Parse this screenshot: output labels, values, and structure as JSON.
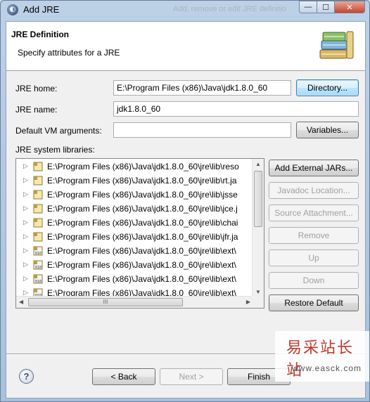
{
  "window": {
    "title": "Add JRE",
    "background_title": "Add, remove or edit JRE definitio",
    "controls": {
      "minimize": "—",
      "maximize": "☐",
      "close": "✕"
    }
  },
  "banner": {
    "title": "JRE Definition",
    "subtitle": "Specify attributes for a JRE"
  },
  "form": {
    "jre_home_label": "JRE home:",
    "jre_home_value": "E:\\Program Files (x86)\\Java\\jdk1.8.0_60",
    "directory_button": "Directory...",
    "jre_name_label": "JRE name:",
    "jre_name_value": "jdk1.8.0_60",
    "vm_args_label": "Default VM arguments:",
    "vm_args_value": "",
    "variables_button": "Variables...",
    "libraries_label": "JRE system libraries:"
  },
  "libraries": [
    "E:\\Program Files (x86)\\Java\\jdk1.8.0_60\\jre\\lib\\reso",
    "E:\\Program Files (x86)\\Java\\jdk1.8.0_60\\jre\\lib\\rt.ja",
    "E:\\Program Files (x86)\\Java\\jdk1.8.0_60\\jre\\lib\\jsse",
    "E:\\Program Files (x86)\\Java\\jdk1.8.0_60\\jre\\lib\\jce.j",
    "E:\\Program Files (x86)\\Java\\jdk1.8.0_60\\jre\\lib\\chai",
    "E:\\Program Files (x86)\\Java\\jdk1.8.0_60\\jre\\lib\\jfr.ja",
    "E:\\Program Files (x86)\\Java\\jdk1.8.0_60\\jre\\lib\\ext\\",
    "E:\\Program Files (x86)\\Java\\jdk1.8.0_60\\jre\\lib\\ext\\",
    "E:\\Program Files (x86)\\Java\\jdk1.8.0_60\\jre\\lib\\ext\\",
    "E:\\Program Files (x86)\\Java\\jdk1.8.0_60\\jre\\lib\\ext\\"
  ],
  "library_buttons": {
    "add_external": "Add External JARs...",
    "javadoc": "Javadoc Location...",
    "source": "Source Attachment...",
    "remove": "Remove",
    "up": "Up",
    "down": "Down",
    "restore": "Restore Default"
  },
  "footer": {
    "help": "?",
    "back": "< Back",
    "next": "Next >",
    "finish": "Finish"
  },
  "watermark": {
    "chinese": "易采站长站",
    "url": "www.easck.com"
  },
  "colors": {
    "titlebar": "#bcd0e6",
    "dialog_bg": "#f0f0f0",
    "button_focus": "#3c7fb1",
    "watermark_red": "#c0392b"
  }
}
